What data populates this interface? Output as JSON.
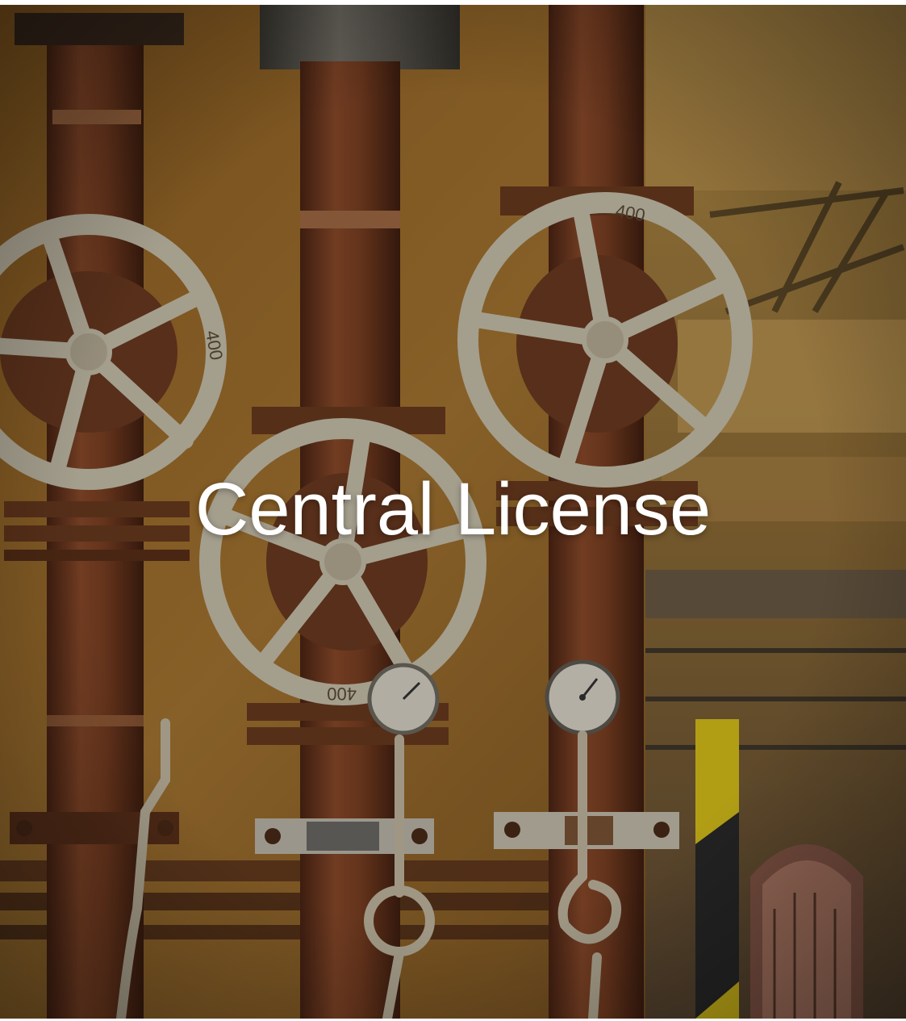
{
  "hero": {
    "title": "Central License",
    "text_color": "#ffffff"
  },
  "scene": {
    "wall_color": "#9a6b2a",
    "pipe_color": "#7a3f22",
    "valve_wheel_color": "#c9c1ac",
    "hazard_stripe_colors": [
      "#d9c11a",
      "#2a2a2a"
    ],
    "valve_wheel_markings": [
      "400",
      "400",
      "400"
    ],
    "icons": [
      "valve-wheel-icon",
      "pressure-gauge-icon"
    ]
  }
}
